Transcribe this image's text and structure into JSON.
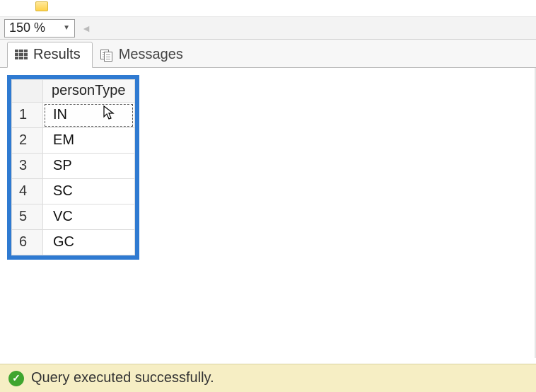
{
  "toolbar": {
    "zoom": "150 %"
  },
  "tabs": {
    "results": "Results",
    "messages": "Messages"
  },
  "grid": {
    "column": "personType",
    "rows": [
      {
        "n": "1",
        "v": "IN"
      },
      {
        "n": "2",
        "v": "EM"
      },
      {
        "n": "3",
        "v": "SP"
      },
      {
        "n": "4",
        "v": "SC"
      },
      {
        "n": "5",
        "v": "VC"
      },
      {
        "n": "6",
        "v": "GC"
      }
    ]
  },
  "status": {
    "message": "Query executed successfully."
  }
}
